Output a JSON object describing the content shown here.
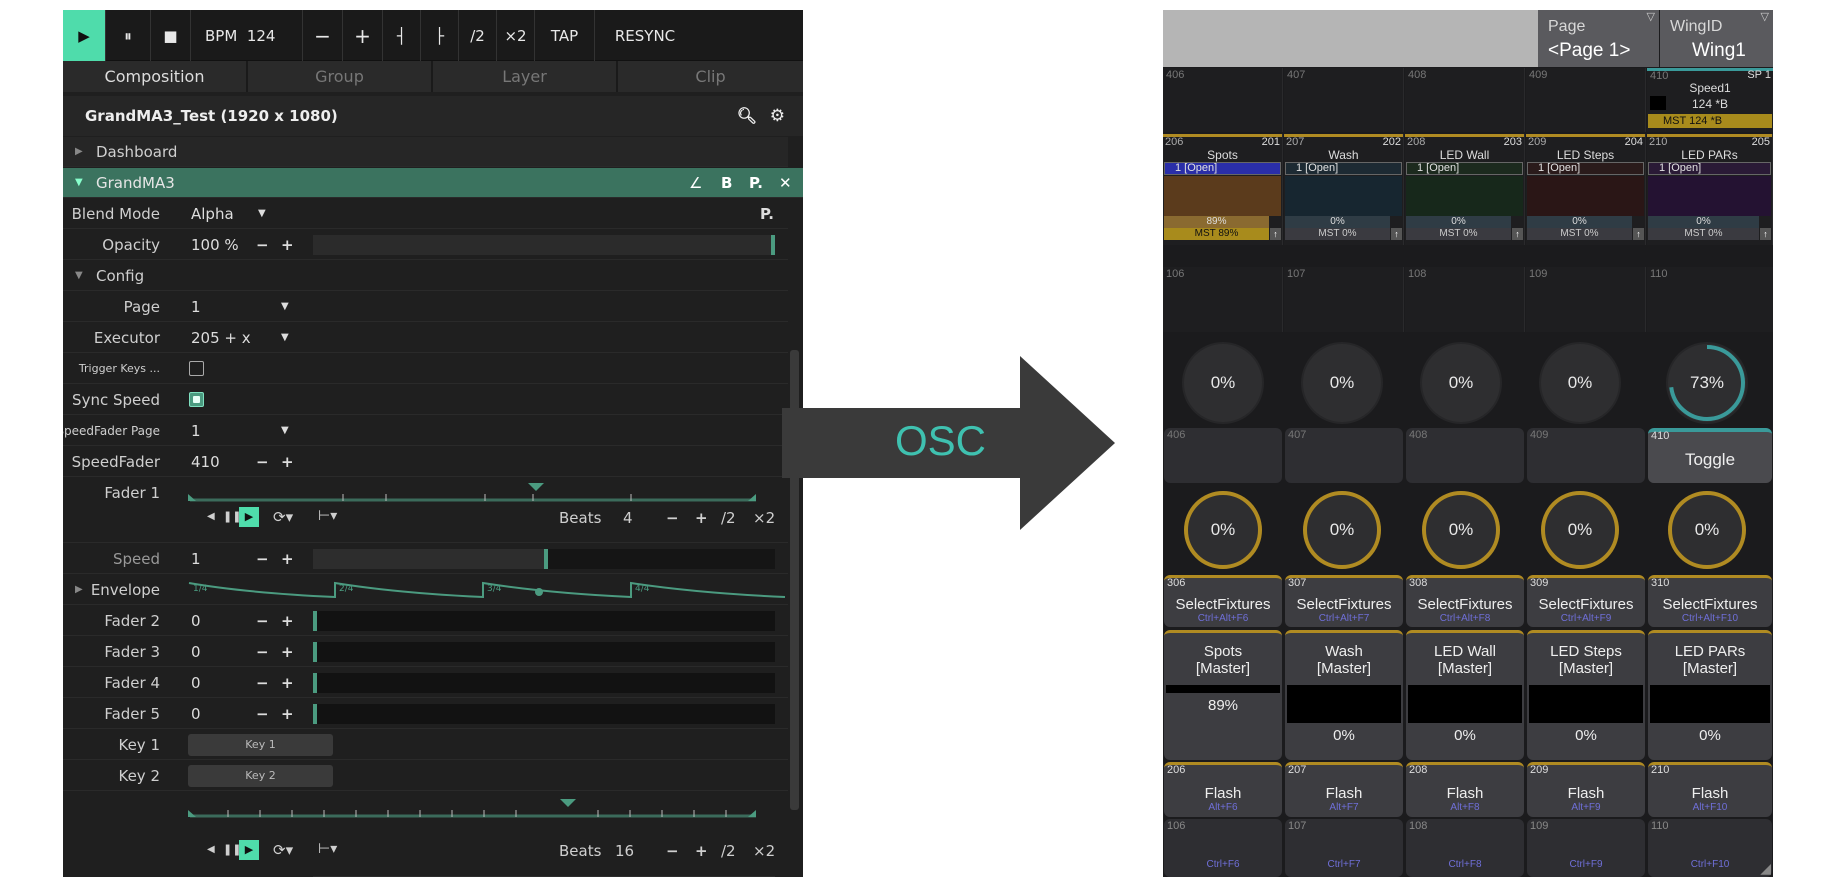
{
  "left": {
    "toolbar": {
      "play": "▶",
      "pause": "⏸",
      "stop": "■",
      "bpm_label": "BPM",
      "bpm_value": "124",
      "minus": "−",
      "plus": "+",
      "nudge_left": "┤",
      "nudge_right": "├",
      "half": "/2",
      "double": "×2",
      "tap": "TAP",
      "resync": "RESYNC"
    },
    "tabs": [
      "Composition",
      "Group",
      "Layer",
      "Clip"
    ],
    "composition_title": "GrandMA3_Test (1920 x 1080)",
    "sections": {
      "dashboard": "Dashboard",
      "plugin": "GrandMA3",
      "config": "Config"
    },
    "plugin_buttons": [
      "∠",
      "B",
      "P.",
      "✕"
    ],
    "blend_mode": {
      "label": "Blend Mode",
      "value": "Alpha",
      "param": "P."
    },
    "opacity": {
      "label": "Opacity",
      "value": "100 %",
      "level": 1.0
    },
    "config": {
      "page": {
        "label": "Page",
        "value": "1"
      },
      "executor": {
        "label": "Executor",
        "value": "205 + x"
      },
      "trigger_keys": {
        "label": "Trigger Keys ...",
        "checked": false
      },
      "sync_speed": {
        "label": "Sync Speed",
        "checked": true
      },
      "speedfader_page": {
        "label": "SpeedFader Page",
        "value": "1"
      },
      "speedfader": {
        "label": "SpeedFader",
        "value": "410"
      }
    },
    "fader1": {
      "label": "Fader 1",
      "beats_label": "Beats",
      "beats_value": "4",
      "half": "/2",
      "double": "×2"
    },
    "speed": {
      "label": "Speed",
      "value": "1",
      "level": 0.5
    },
    "envelope": {
      "label": "Envelope",
      "marks": [
        "1/4",
        "2/4",
        "3/4",
        "4/4"
      ]
    },
    "faders": [
      {
        "label": "Fader 2",
        "value": "0"
      },
      {
        "label": "Fader 3",
        "value": "0"
      },
      {
        "label": "Fader 4",
        "value": "0"
      },
      {
        "label": "Fader 5",
        "value": "0"
      }
    ],
    "keys": [
      {
        "label": "Key 1",
        "button": "Key 1"
      },
      {
        "label": "Key 2",
        "button": "Key 2"
      }
    ],
    "bottom_transport": {
      "beats_label": "Beats",
      "beats_value": "16",
      "half": "/2",
      "double": "×2"
    },
    "accent": "#4b9b80"
  },
  "arrow": {
    "label": "OSC"
  },
  "right": {
    "page": {
      "label": "Page",
      "value": "<Page 1>"
    },
    "wing": {
      "label": "WingID",
      "value": "Wing1"
    },
    "top_nums": [
      "406",
      "407",
      "408",
      "409",
      "410"
    ],
    "speed1": {
      "sp": "SP 1",
      "name": "Speed1",
      "bpm": "124 *B",
      "mst": "MST 124 *B"
    },
    "executors": [
      {
        "num": "206",
        "id": "201",
        "name": "Spots",
        "cue": "1 [Open]",
        "pct": "89%",
        "mst": "MST 89%",
        "color": "#5b3b1c",
        "cuecolor": "#2a2ea8"
      },
      {
        "num": "207",
        "id": "202",
        "name": "Wash",
        "cue": "1 [Open]",
        "pct": "0%",
        "mst": "MST 0%",
        "color": "#172630",
        "cuecolor": "#1d2a33"
      },
      {
        "num": "208",
        "id": "203",
        "name": "LED Wall",
        "cue": "1 [Open]",
        "pct": "0%",
        "mst": "MST 0%",
        "color": "#17281b",
        "cuecolor": "#1c2a1e"
      },
      {
        "num": "209",
        "id": "204",
        "name": "LED Steps",
        "cue": "1 [Open]",
        "pct": "0%",
        "mst": "MST 0%",
        "color": "#2a1616",
        "cuecolor": "#2a1b1b"
      },
      {
        "num": "210",
        "id": "205",
        "name": "LED PARs",
        "cue": "1 [Open]",
        "pct": "0%",
        "mst": "MST 0%",
        "color": "#241232",
        "cuecolor": "#2a1a36"
      }
    ],
    "row106": [
      "106",
      "107",
      "108",
      "109",
      "110"
    ],
    "knobs1": [
      "0%",
      "0%",
      "0%",
      "0%",
      "73%"
    ],
    "knob_levels": [
      0,
      0,
      0,
      0,
      0.73
    ],
    "row406": [
      "406",
      "407",
      "408",
      "409",
      "410"
    ],
    "toggle": "Toggle",
    "knobs2": [
      "0%",
      "0%",
      "0%",
      "0%",
      "0%"
    ],
    "select": [
      {
        "num": "306",
        "label": "SelectFixtures",
        "key": "Ctrl+Alt+F6"
      },
      {
        "num": "307",
        "label": "SelectFixtures",
        "key": "Ctrl+Alt+F7"
      },
      {
        "num": "308",
        "label": "SelectFixtures",
        "key": "Ctrl+Alt+F8"
      },
      {
        "num": "309",
        "label": "SelectFixtures",
        "key": "Ctrl+Alt+F9"
      },
      {
        "num": "310",
        "label": "SelectFixtures",
        "key": "Ctrl+Alt+F10"
      }
    ],
    "masters": [
      {
        "name": "Spots",
        "sub": "[Master]",
        "value": "89%",
        "level": 0.89
      },
      {
        "name": "Wash",
        "sub": "[Master]",
        "value": "0%",
        "level": 0
      },
      {
        "name": "LED Wall",
        "sub": "[Master]",
        "value": "0%",
        "level": 0
      },
      {
        "name": "LED Steps",
        "sub": "[Master]",
        "value": "0%",
        "level": 0
      },
      {
        "name": "LED PARs",
        "sub": "[Master]",
        "value": "0%",
        "level": 0
      }
    ],
    "flash": [
      {
        "num": "206",
        "label": "Flash",
        "key": "Alt+F6"
      },
      {
        "num": "207",
        "label": "Flash",
        "key": "Alt+F7"
      },
      {
        "num": "208",
        "label": "Flash",
        "key": "Alt+F8"
      },
      {
        "num": "209",
        "label": "Flash",
        "key": "Alt+F9"
      },
      {
        "num": "210",
        "label": "Flash",
        "key": "Alt+F10"
      }
    ],
    "bottom": [
      {
        "num": "106",
        "key": "Ctrl+F6"
      },
      {
        "num": "107",
        "key": "Ctrl+F7"
      },
      {
        "num": "108",
        "key": "Ctrl+F8"
      },
      {
        "num": "109",
        "key": "Ctrl+F9"
      },
      {
        "num": "110",
        "key": "Ctrl+F10"
      }
    ],
    "gold": "#b08b22",
    "teal": "#3a9a9a",
    "key_color": "#6f6fd8"
  }
}
